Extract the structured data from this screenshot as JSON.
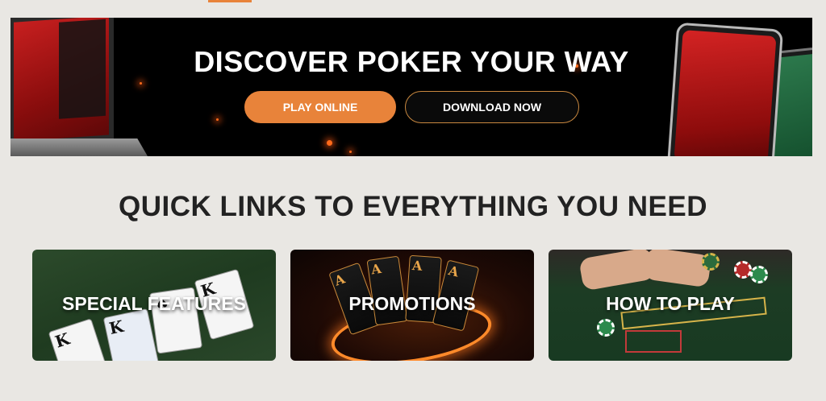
{
  "hero": {
    "title": "DISCOVER POKER YOUR WAY",
    "play_online_label": "PLAY ONLINE",
    "download_label": "DOWNLOAD NOW"
  },
  "quick_links": {
    "title": "QUICK LINKS TO EVERYTHING YOU NEED",
    "cards": [
      {
        "label": "SPECIAL FEATURES"
      },
      {
        "label": "PROMOTIONS"
      },
      {
        "label": "HOW TO PLAY"
      }
    ]
  },
  "colors": {
    "accent": "#e8833a",
    "hero_bg": "#000000",
    "page_bg": "#e9e7e3",
    "title_text": "#222222"
  }
}
